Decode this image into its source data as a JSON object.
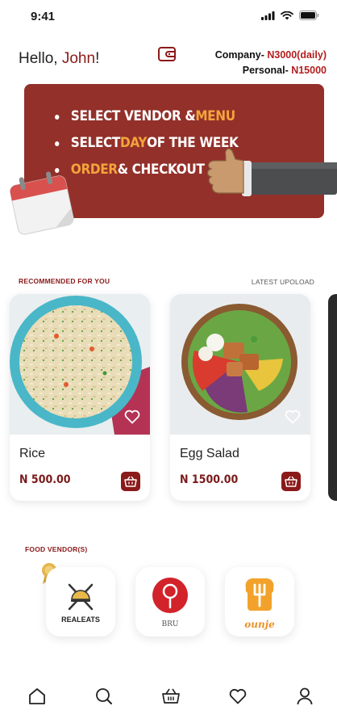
{
  "status_bar": {
    "time": "9:41",
    "icons": [
      "signal-icon",
      "wifi-icon",
      "battery-icon"
    ]
  },
  "header": {
    "greeting_prefix": "Hello, ",
    "user_name": "John",
    "greeting_suffix": "!",
    "wallet_icon": "wallet-icon",
    "company_label": "Company- ",
    "company_amount": "N3000(daily)",
    "personal_label": "Personal- ",
    "personal_amount": "N15000"
  },
  "banner": {
    "line1_text": "SELECT VENDOR & ",
    "line1_highlight": "MENU",
    "line2_prefix": "SELECT ",
    "line2_highlight": "DAY",
    "line2_suffix": " OF THE WEEK",
    "line3_highlight": "ORDER",
    "line3_suffix": " & CHECKOUT"
  },
  "recommended": {
    "label": "RECOMMENDED FOR YOU",
    "latest_label": "LATEST UPOLOAD",
    "items": [
      {
        "name": "Rice",
        "price": "N 500.00"
      },
      {
        "name": "Egg Salad",
        "price": "N 1500.00"
      }
    ]
  },
  "vendors": {
    "label": "FOOD VENDOR(S)",
    "items": [
      {
        "name": "REALEATS"
      },
      {
        "name": "BRU"
      },
      {
        "name": "ounje"
      }
    ]
  },
  "bottom_nav": {
    "items": [
      "home-icon",
      "search-icon",
      "basket-icon",
      "heart-icon",
      "profile-icon"
    ]
  },
  "colors": {
    "brand": "#8b1a1a",
    "banner": "#93302a",
    "accent": "#f3a43b"
  }
}
